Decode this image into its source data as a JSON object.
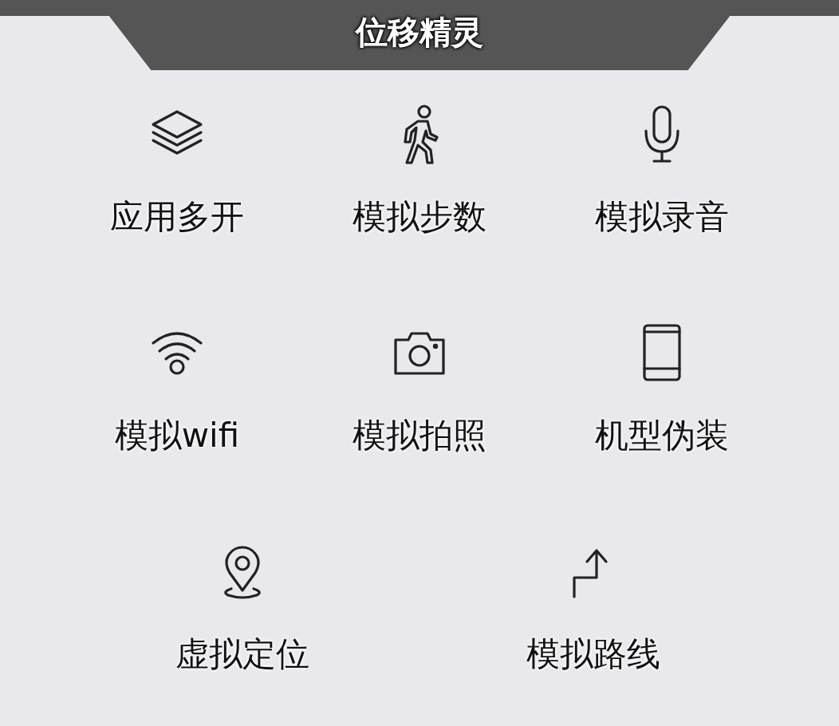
{
  "header": {
    "title": "位移精灵"
  },
  "rows": [
    [
      {
        "label": "应用多开",
        "kind": "layers"
      },
      {
        "label": "模拟步数",
        "kind": "walker"
      },
      {
        "label": "模拟录音",
        "kind": "microphone"
      }
    ],
    [
      {
        "label": "模拟wifi",
        "kind": "wifi"
      },
      {
        "label": "模拟拍照",
        "kind": "camera"
      },
      {
        "label": "机型伪装",
        "kind": "phone"
      }
    ],
    [
      {
        "label": "虚拟定位",
        "kind": "pin"
      },
      {
        "label": "模拟路线",
        "kind": "route"
      }
    ]
  ]
}
